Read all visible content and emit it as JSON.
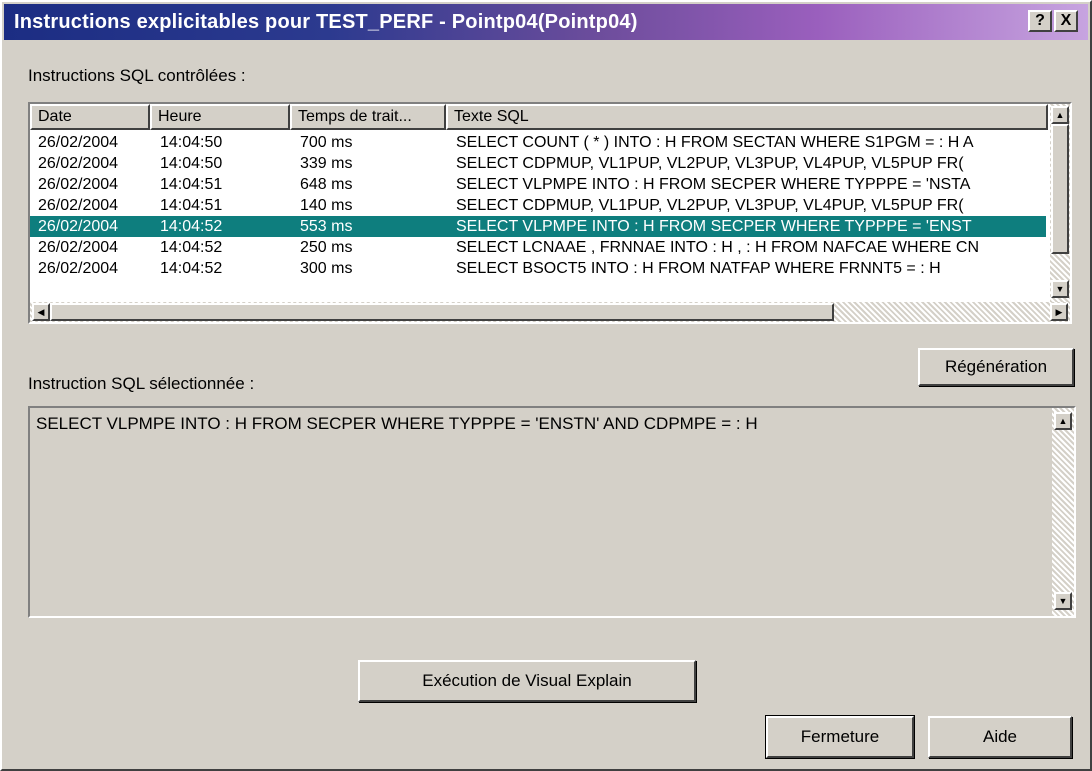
{
  "window": {
    "title": "Instructions explicitables pour TEST_PERF - Pointp04(Pointp04)",
    "help_button": "?",
    "close_button": "X"
  },
  "controlled": {
    "label": "Instructions SQL contrôlées :",
    "columns": [
      "Date",
      "Heure",
      "Temps de trait...",
      "Texte SQL"
    ],
    "rows": [
      {
        "date": "26/02/2004",
        "time": "14:04:50",
        "duration": "700 ms",
        "sql": "SELECT COUNT ( * ) INTO : H FROM SECTAN WHERE S1PGM = : H A"
      },
      {
        "date": "26/02/2004",
        "time": "14:04:50",
        "duration": "339 ms",
        "sql": "SELECT CDPMUP, VL1PUP, VL2PUP, VL3PUP, VL4PUP, VL5PUP FR("
      },
      {
        "date": "26/02/2004",
        "time": "14:04:51",
        "duration": "648 ms",
        "sql": "SELECT VLPMPE INTO : H FROM SECPER WHERE TYPPPE = 'NSTA"
      },
      {
        "date": "26/02/2004",
        "time": "14:04:51",
        "duration": "140 ms",
        "sql": "SELECT CDPMUP, VL1PUP, VL2PUP, VL3PUP, VL4PUP, VL5PUP FR("
      },
      {
        "date": "26/02/2004",
        "time": "14:04:52",
        "duration": "553 ms",
        "sql": "SELECT VLPMPE INTO : H FROM SECPER WHERE TYPPPE = 'ENST",
        "selected": true
      },
      {
        "date": "26/02/2004",
        "time": "14:04:52",
        "duration": "250 ms",
        "sql": "SELECT LCNAAE , FRNNAE INTO : H , : H FROM NAFCAE WHERE CN"
      },
      {
        "date": "26/02/2004",
        "time": "14:04:52",
        "duration": "300 ms",
        "sql": "SELECT BSOCT5 INTO : H FROM NATFAP WHERE FRNNT5 = : H"
      }
    ]
  },
  "selected_sql": {
    "label": "Instruction SQL sélectionnée :",
    "text": "SELECT VLPMPE INTO : H FROM SECPER WHERE TYPPPE = 'ENSTN' AND CDPMPE = : H"
  },
  "buttons": {
    "regeneration": "Régénération",
    "visual_explain": "Exécution de Visual Explain",
    "close": "Fermeture",
    "help": "Aide"
  },
  "colors": {
    "selection": "#0e7e7e",
    "title_start": "#1c2d83",
    "title_end": "#c7a4e0",
    "face": "#d4d0c8"
  }
}
